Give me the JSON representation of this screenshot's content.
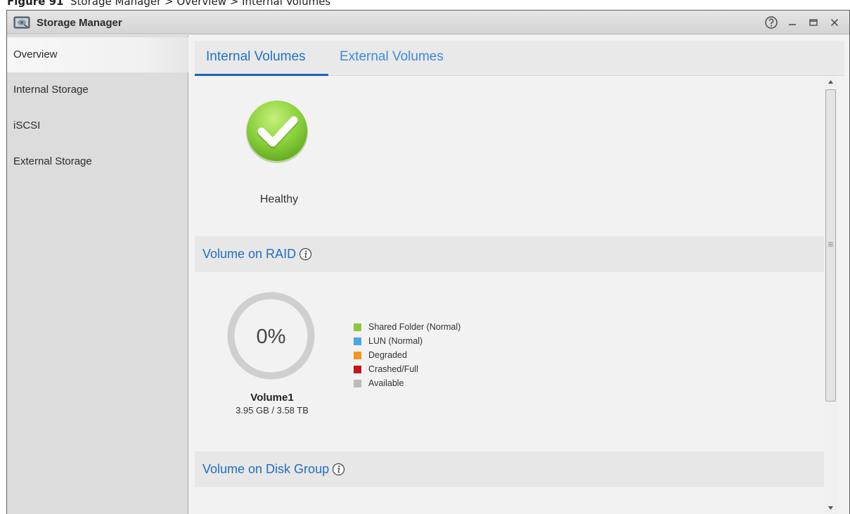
{
  "figure_caption": {
    "label": "Figure 91",
    "text": "Storage Manager > Overview > Internal Volumes"
  },
  "window": {
    "title": "Storage Manager",
    "controls": [
      "help-icon",
      "minimize-icon",
      "maximize-icon",
      "close-icon"
    ]
  },
  "sidebar": {
    "items": [
      {
        "label": "Overview",
        "active": true
      },
      {
        "label": "Internal Storage",
        "active": false
      },
      {
        "label": "iSCSI",
        "active": false
      },
      {
        "label": "External Storage",
        "active": false
      }
    ]
  },
  "tabs": [
    {
      "label": "Internal Volumes",
      "active": true
    },
    {
      "label": "External Volumes",
      "active": false
    }
  ],
  "health": {
    "status": "Healthy",
    "icon": "checkmark-icon",
    "color": "#8cd13d"
  },
  "raid_section": {
    "title": "Volume on RAID",
    "icon": "info-icon"
  },
  "volume": {
    "usage_percent_label": "0%",
    "usage_fraction": 0,
    "name": "Volume1",
    "size": "3.95 GB / 3.58 TB"
  },
  "legend": [
    {
      "label": "Shared Folder (Normal)",
      "color": "#8dc63f"
    },
    {
      "label": "LUN (Normal)",
      "color": "#4aa6e8"
    },
    {
      "label": "Degraded",
      "color": "#f7941d"
    },
    {
      "label": "Crashed/Full",
      "color": "#c4161c"
    },
    {
      "label": "Available",
      "color": "#bbbbbb"
    }
  ],
  "disk_group_section": {
    "title": "Volume on Disk Group",
    "icon": "info-icon"
  },
  "colors": {
    "accent": "#1f72c9",
    "tab_underline": "#1a62b8"
  }
}
